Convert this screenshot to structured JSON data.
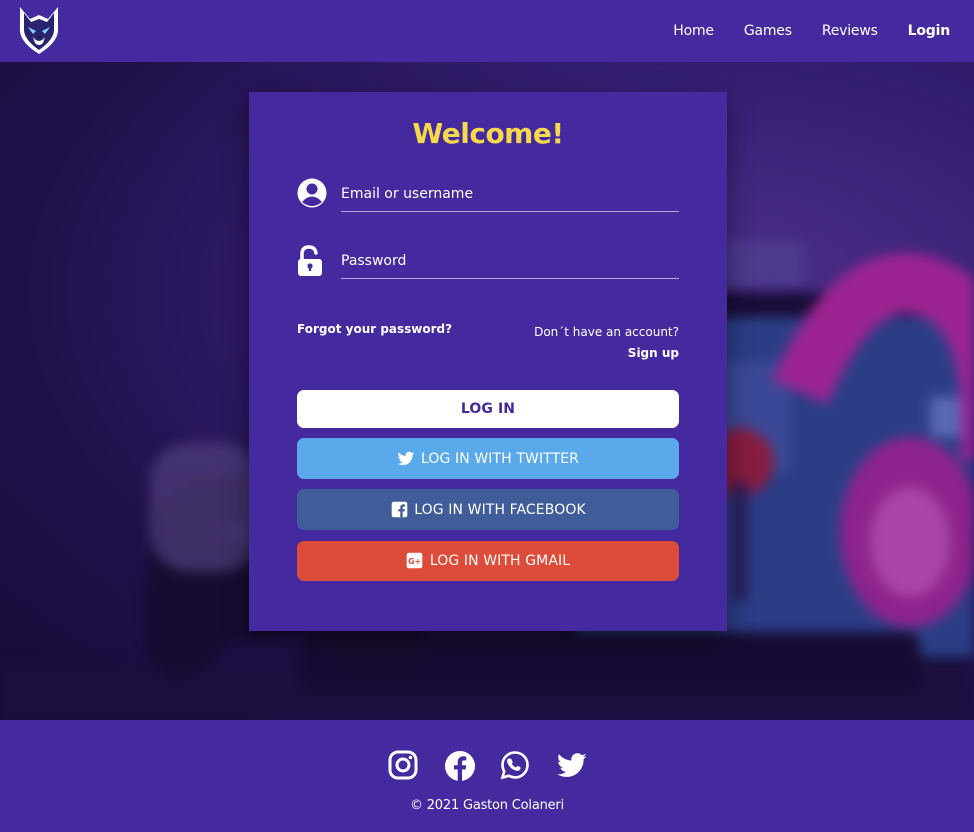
{
  "header": {
    "logo_icon": "wolf-logo",
    "nav": [
      {
        "label": "Home"
      },
      {
        "label": "Games"
      },
      {
        "label": "Reviews"
      },
      {
        "label": "Login",
        "active": true
      }
    ]
  },
  "login": {
    "title": "Welcome!",
    "email": {
      "placeholder": "Email or username",
      "icon": "user-circle-icon"
    },
    "password": {
      "placeholder": "Password",
      "icon": "unlock-icon"
    },
    "forgot_label": "Forgot your password?",
    "no_account_label": "Don´t have an account?",
    "signup_label": "Sign up",
    "buttons": {
      "login": "LOG IN",
      "twitter": "LOG IN WITH TWITTER",
      "facebook": "LOG IN WITH FACEBOOK",
      "gmail": "LOG IN WITH GMAIL"
    }
  },
  "footer": {
    "social_icons": [
      "instagram-icon",
      "facebook-icon",
      "whatsapp-icon",
      "twitter-icon"
    ],
    "copyright": "© 2021 Gaston Colaneri"
  },
  "colors": {
    "brand_purple": "#45299f",
    "title_yellow": "#f5d94a",
    "twitter_blue": "#5aa9ea",
    "facebook_blue": "#405d9a",
    "gmail_red": "#dd4b39"
  }
}
